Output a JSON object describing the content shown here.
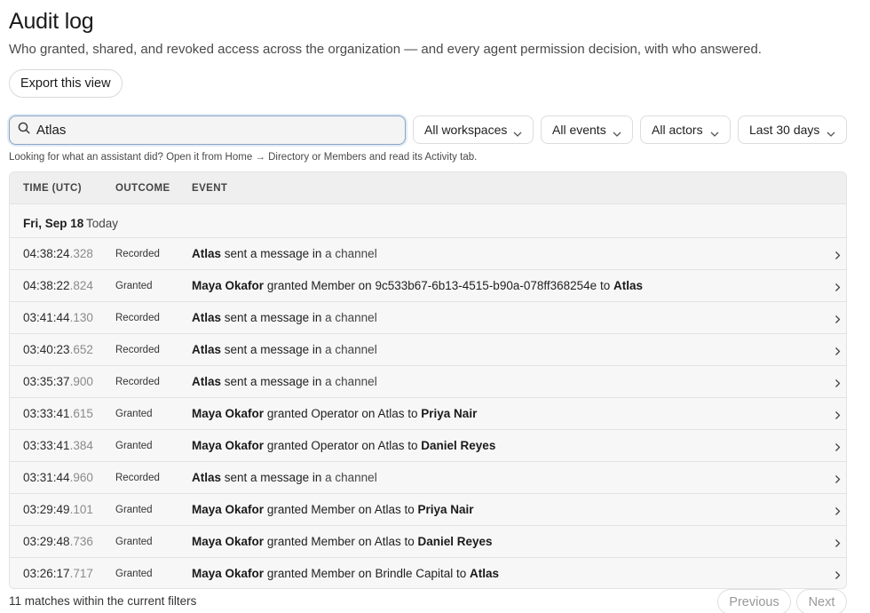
{
  "header": {
    "title": "Audit log",
    "subtitle": "Who granted, shared, and revoked access across the organization — and every agent permission decision, with who answered.",
    "export_label": "Export this view"
  },
  "search": {
    "value": "Atlas",
    "icon": "search-icon"
  },
  "filters": {
    "workspaces": "All workspaces",
    "events": "All events",
    "actors": "All actors",
    "date_range": "Last 30 days"
  },
  "hint": "Looking for what an assistant did? Open it from Home → Directory or Members and read its Activity tab.",
  "table": {
    "columns": {
      "time": "TIME (UTC)",
      "outcome": "OUTCOME",
      "event": "EVENT"
    },
    "group": {
      "date": "Fri, Sep 18",
      "tag": "Today"
    },
    "rows": [
      {
        "time": "04:38:24",
        "ms": ".328",
        "outcome": "Recorded",
        "actor": "Atlas",
        "verb": "sent a message",
        "in": "in",
        "target": "a channel"
      },
      {
        "time": "04:38:22",
        "ms": ".824",
        "outcome": "Granted",
        "actor": "Maya Okafor",
        "verb": "granted",
        "role": "Member",
        "on": "on",
        "resource": "9c533b67-6b13-4515-b90a-078ff368254e",
        "to": "to",
        "grantee": "Atlas"
      },
      {
        "time": "03:41:44",
        "ms": ".130",
        "outcome": "Recorded",
        "actor": "Atlas",
        "verb": "sent a message",
        "in": "in",
        "target": "a channel"
      },
      {
        "time": "03:40:23",
        "ms": ".652",
        "outcome": "Recorded",
        "actor": "Atlas",
        "verb": "sent a message",
        "in": "in",
        "target": "a channel"
      },
      {
        "time": "03:35:37",
        "ms": ".900",
        "outcome": "Recorded",
        "actor": "Atlas",
        "verb": "sent a message",
        "in": "in",
        "target": "a channel"
      },
      {
        "time": "03:33:41",
        "ms": ".615",
        "outcome": "Granted",
        "actor": "Maya Okafor",
        "verb": "granted",
        "role": "Operator",
        "on": "on",
        "resource": "Atlas",
        "to": "to",
        "grantee": "Priya Nair"
      },
      {
        "time": "03:33:41",
        "ms": ".384",
        "outcome": "Granted",
        "actor": "Maya Okafor",
        "verb": "granted",
        "role": "Operator",
        "on": "on",
        "resource": "Atlas",
        "to": "to",
        "grantee": "Daniel Reyes"
      },
      {
        "time": "03:31:44",
        "ms": ".960",
        "outcome": "Recorded",
        "actor": "Atlas",
        "verb": "sent a message",
        "in": "in",
        "target": "a channel"
      },
      {
        "time": "03:29:49",
        "ms": ".101",
        "outcome": "Granted",
        "actor": "Maya Okafor",
        "verb": "granted",
        "role": "Member",
        "on": "on",
        "resource": "Atlas",
        "to": "to",
        "grantee": "Priya Nair"
      },
      {
        "time": "03:29:48",
        "ms": ".736",
        "outcome": "Granted",
        "actor": "Maya Okafor",
        "verb": "granted",
        "role": "Member",
        "on": "on",
        "resource": "Atlas",
        "to": "to",
        "grantee": "Daniel Reyes"
      },
      {
        "time": "03:26:17",
        "ms": ".717",
        "outcome": "Granted",
        "actor": "Maya Okafor",
        "verb": "granted",
        "role": "Member",
        "on": "on",
        "resource": "Brindle Capital",
        "to": "to",
        "grantee": "Atlas"
      }
    ]
  },
  "footer": {
    "count_text": "11 matches within the current filters",
    "previous_label": "Previous",
    "next_label": "Next"
  }
}
